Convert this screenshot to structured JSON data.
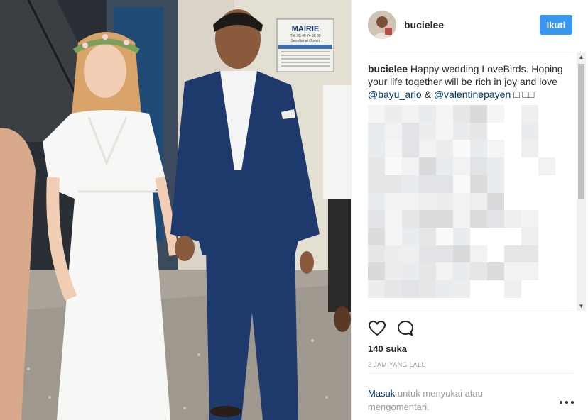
{
  "post": {
    "username": "bucielee",
    "follow_label": "Ikuti",
    "caption_user": "bucielee",
    "caption_text_1": " Happy wedding LoveBirds. Hoping your life together will be rich in joy and love ",
    "mention_1": "@bayu_ario",
    "caption_text_2": " & ",
    "mention_2": "@valentinepayen",
    "caption_tail": " □ □□",
    "likes": "140 suka",
    "timestamp": "2 JAM YANG LALU",
    "login_link": "Masuk",
    "login_text": " untuk menyukai atau mengomentari."
  },
  "photo": {
    "sign_title": "MAIRIE",
    "sign_phone": "Tél: 05 46 74 90 80",
    "sign_subtitle": "Secrétariat Ouvert"
  },
  "icons": {
    "like": "heart-icon",
    "comment": "comment-icon",
    "more": "more-options-icon"
  },
  "colors": {
    "accent": "#3897f0",
    "link": "#003569",
    "muted": "#999999",
    "text": "#262626"
  }
}
